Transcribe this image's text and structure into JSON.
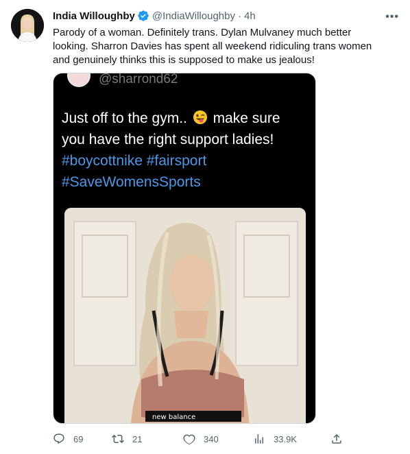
{
  "author": {
    "display_name": "India Willoughby",
    "handle": "@IndiaWilloughby",
    "separator": "·",
    "time": "4h",
    "verified_icon": "verified-badge-icon"
  },
  "tweet": {
    "text": "Parody of a woman. Definitely trans. Dylan Mulvaney much better looking. Sharron Davies has spent all weekend ridiculing trans women and genuinely thinks this is supposed to make us jealous!"
  },
  "more_icon": "•••",
  "embedded_media": {
    "handle": "@sharrond62",
    "line1_a": "Just off to the gym..",
    "line1_b": "make sure",
    "line2": "you have the right support ladies!",
    "hashtag_line1": "#boycottnike #fairsport",
    "hashtag_line2": "#SaveWomensSports",
    "bra_brand": "new balance"
  },
  "actions": {
    "replies": "69",
    "retweets": "21",
    "likes": "340",
    "views": "33.9K"
  },
  "colors": {
    "accent": "#1d9bf0",
    "hashtag": "#4a99e9",
    "muted": "#536471"
  }
}
